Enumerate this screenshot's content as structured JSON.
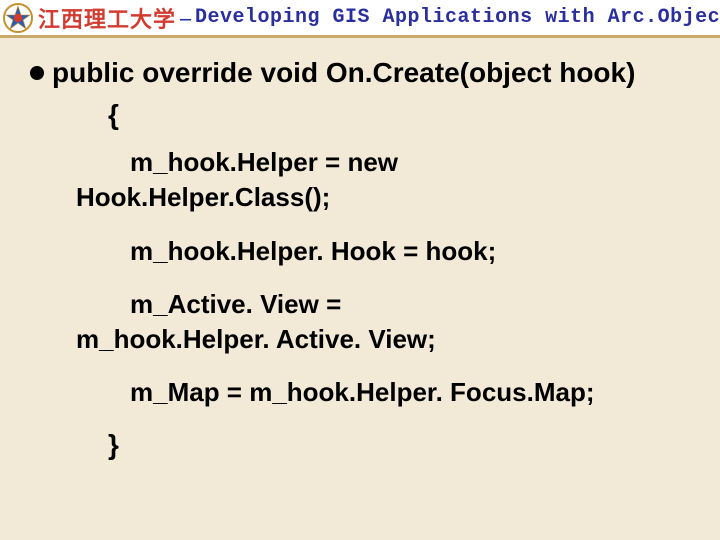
{
  "header": {
    "university": "江西理工大学",
    "dash": "–",
    "course": "Developing GIS Applications with Arc.Objects using C#. NE"
  },
  "code": {
    "signature": "public override void On.Create(object hook)",
    "open_brace": "{",
    "lines": [
      {
        "first": "m_hook.Helper = new",
        "cont": "Hook.Helper.Class();"
      },
      {
        "first": "m_hook.Helper. Hook = hook;"
      },
      {
        "first": "m_Active. View =",
        "cont": "m_hook.Helper. Active. View;"
      },
      {
        "first": "m_Map = m_hook.Helper. Focus.Map;"
      }
    ],
    "close_brace": "}"
  }
}
